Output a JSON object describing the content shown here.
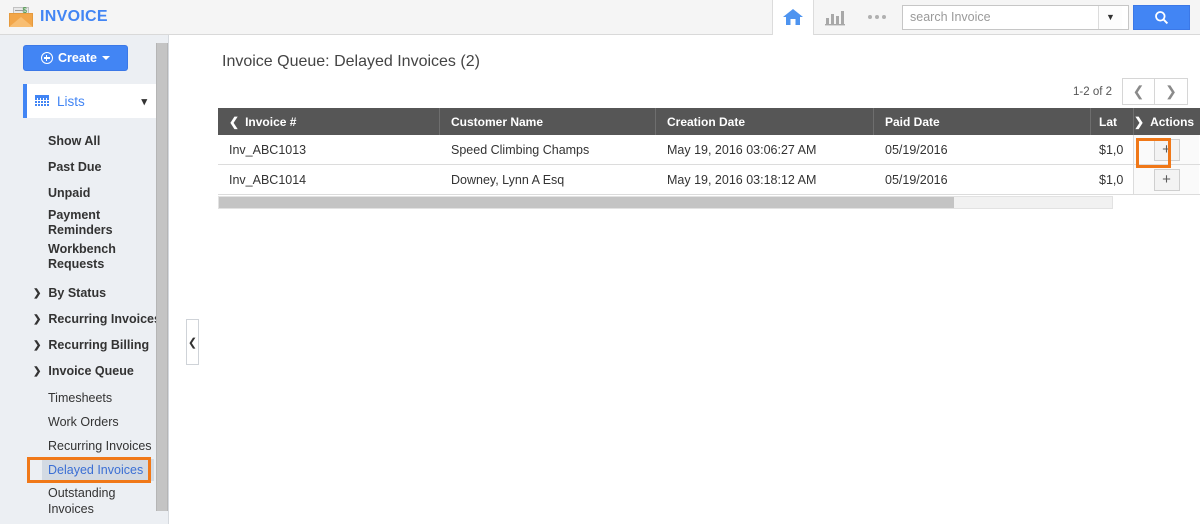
{
  "header": {
    "brand": "INVOICE",
    "logo_icon": "envelope-money-icon",
    "home_icon": "home-icon",
    "reports_icon": "bar-chart-icon",
    "more_icon": "ellipsis-icon",
    "search_placeholder": "search Invoice",
    "search_value": "",
    "search_dropdown_icon": "chevron-down-icon",
    "search_button_icon": "search-icon"
  },
  "sidebar": {
    "create_label": "Create",
    "create_icon": "circle-plus-icon",
    "create_caret": "caret-down-icon",
    "lists_label": "Lists",
    "lists_icon": "grid-icon",
    "lists_chevron": "chevron-down-icon",
    "links": [
      {
        "label": "Show All"
      },
      {
        "label": "Past Due"
      },
      {
        "label": "Unpaid"
      },
      {
        "label": "Payment Reminders"
      },
      {
        "label": "Workbench Requests"
      }
    ],
    "groups": [
      {
        "label": "By Status",
        "icon": "chevron-right-icon",
        "expanded": false
      },
      {
        "label": "Recurring Invoices",
        "icon": "chevron-right-icon",
        "expanded": false
      },
      {
        "label": "Recurring Billing",
        "icon": "chevron-right-icon",
        "expanded": false
      },
      {
        "label": "Invoice Queue",
        "icon": "chevron-down-icon",
        "expanded": true
      }
    ],
    "queue_items": [
      {
        "label": "Timesheets",
        "selected": false
      },
      {
        "label": "Work Orders",
        "selected": false
      },
      {
        "label": "Recurring Invoices",
        "selected": false
      },
      {
        "label": "Delayed Invoices",
        "selected": true
      },
      {
        "label": "Outstanding Invoices",
        "selected": false
      }
    ],
    "collapse_icon": "chevron-left-icon"
  },
  "main": {
    "title": "Invoice Queue: Delayed Invoices (2)",
    "pagination": {
      "range": "1-2 of 2",
      "prev_icon": "chevron-left-icon",
      "next_icon": "chevron-right-icon"
    },
    "table": {
      "columns": [
        {
          "label": "Invoice #",
          "icon": "chevron-left-icon"
        },
        {
          "label": "Customer Name",
          "icon": ""
        },
        {
          "label": "Creation Date",
          "icon": ""
        },
        {
          "label": "Paid Date",
          "icon": ""
        },
        {
          "label": "Lat",
          "icon": ""
        },
        {
          "label": "Actions",
          "icon": "chevron-right-icon"
        }
      ],
      "rows": [
        {
          "invoice": "Inv_ABC1013",
          "customer": "Speed Climbing Champs",
          "creation": "May 19, 2016 03:06:27 AM",
          "paid": "05/19/2016",
          "late": "$1,0",
          "action_icon": "plus-icon"
        },
        {
          "invoice": "Inv_ABC1014",
          "customer": "Downey, Lynn A Esq",
          "creation": "May 19, 2016 03:18:12 AM",
          "paid": "05/19/2016",
          "late": "$1,0",
          "action_icon": "plus-icon"
        }
      ]
    }
  },
  "colors": {
    "brand_blue": "#4285f4",
    "highlight_orange": "#f07818",
    "table_header_gray": "#565656",
    "sidebar_bg": "#eceff3"
  }
}
